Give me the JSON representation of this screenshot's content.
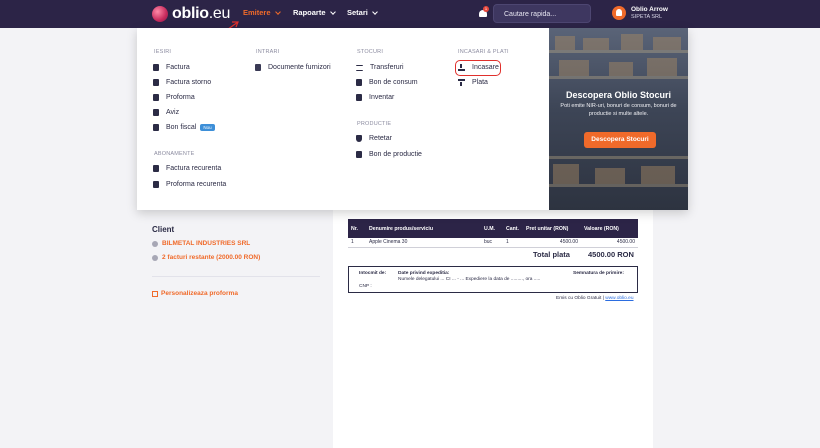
{
  "brand": {
    "logo": "oblio",
    "logo_suffix": ".eu"
  },
  "nav": {
    "emitere": "Emitere",
    "rapoarte": "Rapoarte",
    "setari": "Setari"
  },
  "notifications": {
    "count": "1"
  },
  "search": {
    "placeholder": "Cautare rapida..."
  },
  "user": {
    "name": "Oblio Arrow",
    "company": "SIPETA SRL"
  },
  "dropdown": {
    "iesiri": {
      "heading": "IESIRI",
      "items": [
        "Factura",
        "Factura storno",
        "Proforma",
        "Aviz",
        "Bon fiscal"
      ],
      "bon_fiscal_badge": "Nou"
    },
    "abonamente": {
      "heading": "ABONAMENTE",
      "items": [
        "Factura recurenta",
        "Proforma recurenta"
      ]
    },
    "intrari": {
      "heading": "INTRARI",
      "items": [
        "Documente furnizori"
      ]
    },
    "stocuri": {
      "heading": "STOCURI",
      "items": [
        "Transferuri",
        "Bon de consum",
        "Inventar"
      ]
    },
    "productie": {
      "heading": "PRODUCTIE",
      "items": [
        "Retetar",
        "Bon de productie"
      ]
    },
    "incasari": {
      "heading": "INCASARI & PLATI",
      "items": [
        "Incasare",
        "Plata"
      ]
    },
    "promo": {
      "title": "Descopera Oblio Stocuri",
      "text": "Poti emite NIR-uri, bonuri de consum, bonuri de productie si multe altele.",
      "button": "Descopera Stocuri"
    }
  },
  "client": {
    "title": "Client",
    "name": "BILMETAL INDUSTRIES SRL",
    "overdue": "2 facturi restante (2000.00 RON)",
    "personalize": "Personalizeaza proforma"
  },
  "invoice": {
    "headers": [
      "Nr.",
      "Denumire produs/serviciu",
      "U.M.",
      "Cant.",
      "Pret unitar (RON)",
      "Valoare (RON)"
    ],
    "rows": [
      [
        "1",
        "Apple Cinema 30",
        "buc",
        "1",
        "4500.00",
        "4500.00"
      ]
    ],
    "total_label": "Total plata",
    "total_value": "4500.00 RON",
    "intocmit": "Intocmit de:",
    "cnp": "CNP :",
    "expeditie": "Date privind expeditia:",
    "expeditie_detail": "Numele delegatului ... CI ... - ... Expediere la data de ........., ora .....",
    "semnatura": "Semnatura de primire:",
    "footer_prefix": "Emis cu Oblio Gratuit |",
    "footer_link": "www.oblio.eu"
  },
  "colors": {
    "nav_bg": "#2c2447",
    "accent": "#f06a2a",
    "highlight": "#e0302c",
    "badge": "#3d8fd8"
  }
}
